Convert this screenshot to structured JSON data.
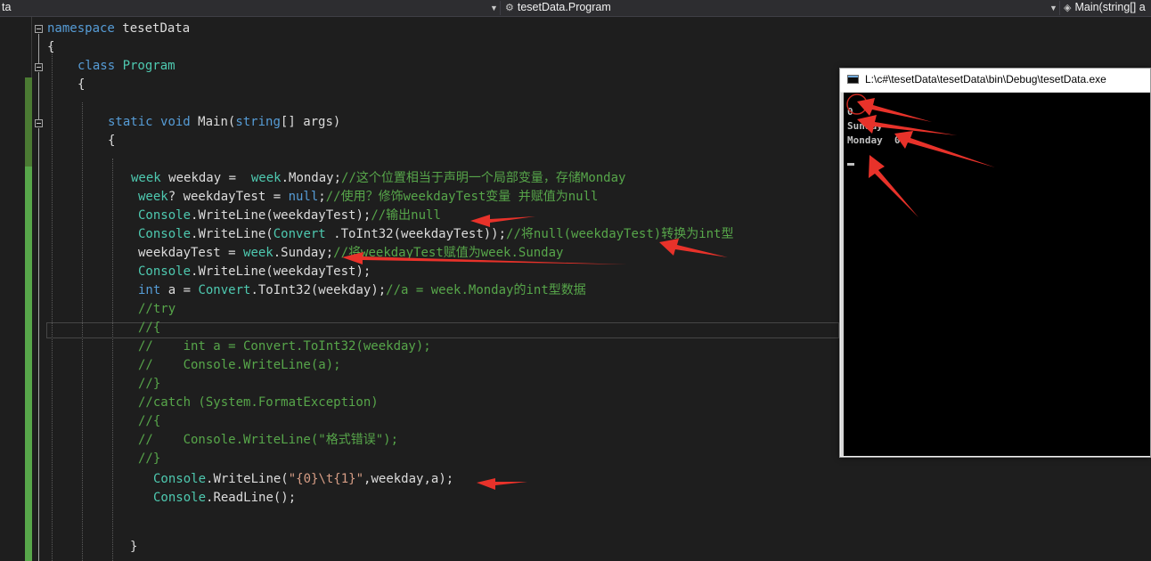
{
  "navbar": {
    "project_dropdown": "ta",
    "type_dropdown": "tesetData.Program",
    "member_dropdown": "Main(string[] a"
  },
  "editor": {
    "lines": [
      [
        {
          "t": "namespace ",
          "c": "kw"
        },
        {
          "t": "tesetData",
          "c": "pl"
        }
      ],
      [
        {
          "t": "{",
          "c": "pl"
        }
      ],
      [
        {
          "t": "class ",
          "c": "kw"
        },
        {
          "t": "Program",
          "c": "ty"
        }
      ],
      [
        {
          "t": "{",
          "c": "pl"
        }
      ],
      [
        {
          "t": "static ",
          "c": "kw"
        },
        {
          "t": "void ",
          "c": "kw"
        },
        {
          "t": "Main(",
          "c": "pl"
        },
        {
          "t": "string",
          "c": "kw"
        },
        {
          "t": "[] args)",
          "c": "pl"
        }
      ],
      [
        {
          "t": "{",
          "c": "pl"
        }
      ],
      [
        {
          "t": "week ",
          "c": "ty"
        },
        {
          "t": "weekday =  ",
          "c": "pl"
        },
        {
          "t": "week",
          "c": "ty"
        },
        {
          "t": ".Monday;",
          "c": "pl"
        },
        {
          "t": "//这个位置相当于声明一个局部变量，存储Monday",
          "c": "cm"
        }
      ],
      [
        {
          "t": "week",
          "c": "ty"
        },
        {
          "t": "? weekdayTest = ",
          "c": "pl"
        },
        {
          "t": "null",
          "c": "kw"
        },
        {
          "t": ";",
          "c": "pl"
        },
        {
          "t": "//使用？修饰weekdayTest变量 并赋值为null",
          "c": "cm"
        }
      ],
      [
        {
          "t": "Console",
          "c": "ty"
        },
        {
          "t": ".WriteLine(weekdayTest);",
          "c": "pl"
        },
        {
          "t": "//输出null",
          "c": "cm"
        }
      ],
      [
        {
          "t": "Console",
          "c": "ty"
        },
        {
          "t": ".WriteLine(",
          "c": "pl"
        },
        {
          "t": "Convert",
          "c": "ty"
        },
        {
          "t": " .ToInt32(weekdayTest));",
          "c": "pl"
        },
        {
          "t": "//将null(weekdayTest)转换为int型",
          "c": "cm"
        }
      ],
      [
        {
          "t": "weekdayTest = ",
          "c": "pl"
        },
        {
          "t": "week",
          "c": "ty"
        },
        {
          "t": ".Sunday;",
          "c": "pl"
        },
        {
          "t": "//将weekdayTest赋值为week.Sunday",
          "c": "cm"
        }
      ],
      [
        {
          "t": "Console",
          "c": "ty"
        },
        {
          "t": ".WriteLine(weekdayTest);",
          "c": "pl"
        }
      ],
      [
        {
          "t": "int ",
          "c": "kw"
        },
        {
          "t": "a = ",
          "c": "pl"
        },
        {
          "t": "Convert",
          "c": "ty"
        },
        {
          "t": ".ToInt32(weekday);",
          "c": "pl"
        },
        {
          "t": "//a = week.Monday的int型数据",
          "c": "cm"
        }
      ],
      [
        {
          "t": "//try",
          "c": "cm"
        }
      ],
      [
        {
          "t": "//{",
          "c": "cm"
        }
      ],
      [
        {
          "t": "//    int a = Convert.ToInt32(weekday);",
          "c": "cm"
        }
      ],
      [
        {
          "t": "//    Console.WriteLine(a);",
          "c": "cm"
        }
      ],
      [
        {
          "t": "//}",
          "c": "cm"
        }
      ],
      [
        {
          "t": "//catch (System.FormatException)",
          "c": "cm"
        }
      ],
      [
        {
          "t": "//{",
          "c": "cm"
        }
      ],
      [
        {
          "t": "//    Console.WriteLine(\"格式错误\");",
          "c": "cm"
        }
      ],
      [
        {
          "t": "//}",
          "c": "cm"
        }
      ],
      [
        {
          "t": "Console",
          "c": "ty"
        },
        {
          "t": ".WriteLine(",
          "c": "pl"
        },
        {
          "t": "\"{0}\\t{1}\"",
          "c": "st"
        },
        {
          "t": ",weekday,a);",
          "c": "pl"
        }
      ],
      [
        {
          "t": "Console",
          "c": "ty"
        },
        {
          "t": ".ReadLine();",
          "c": "pl"
        }
      ],
      [
        {
          "t": "}",
          "c": "pl"
        }
      ]
    ]
  },
  "console": {
    "title": "L:\\c#\\tesetData\\tesetData\\bin\\Debug\\tesetData.exe",
    "output_lines": [
      "",
      "0",
      "Sunday",
      "Monday  0"
    ]
  },
  "colors": {
    "keyword": "#569cd6",
    "type": "#4ec9b0",
    "comment": "#57a64a",
    "string": "#d69d85",
    "plain": "#dcdcdc",
    "annotation": "#e8322a"
  }
}
